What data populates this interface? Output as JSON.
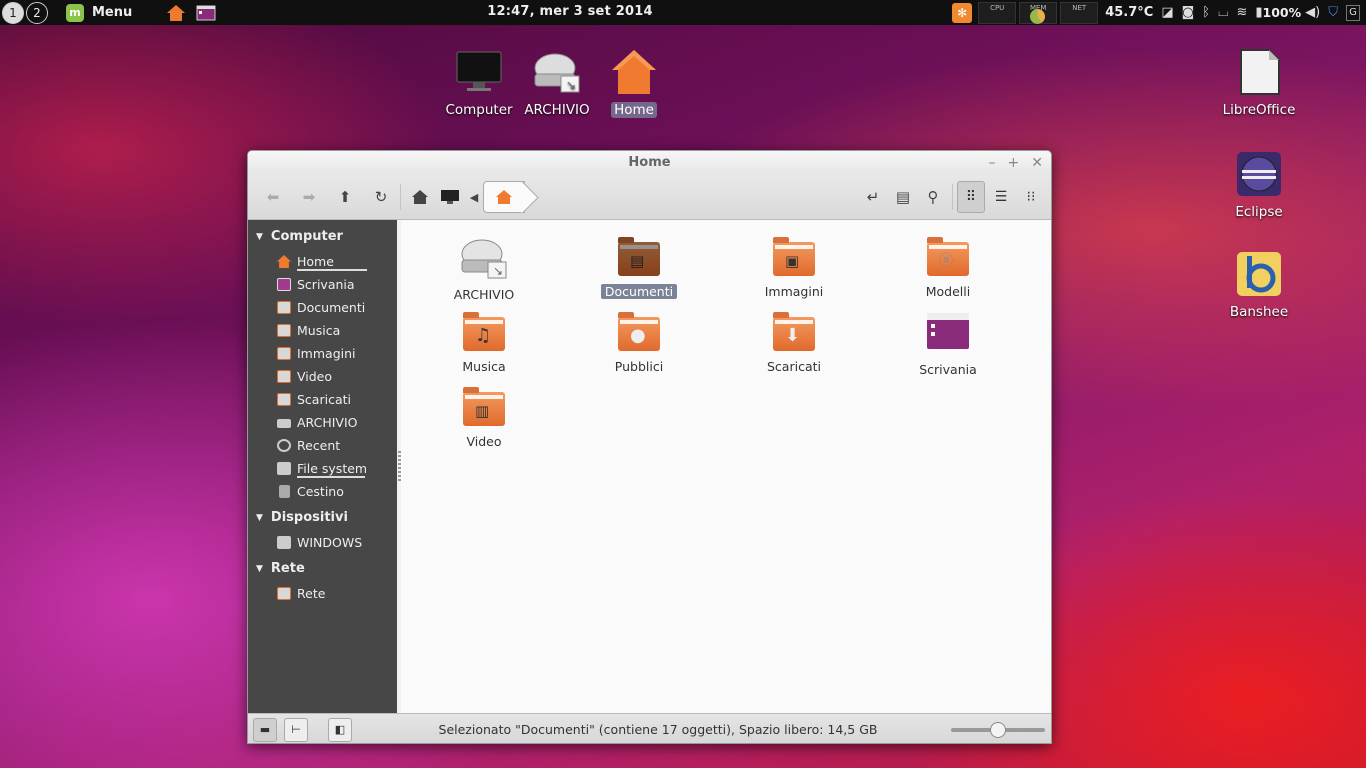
{
  "panel": {
    "workspaces": [
      "1",
      "2"
    ],
    "menu_label": "Menu",
    "clock": "12:47, mer  3 set 2014",
    "applets": {
      "cpu": "CPU",
      "mem": "MEM",
      "net": "NET"
    },
    "temperature": "45.7°C",
    "battery": "100%"
  },
  "desktop": {
    "icons": [
      {
        "label": "Computer"
      },
      {
        "label": "ARCHIVIO"
      },
      {
        "label": "Home"
      },
      {
        "label": "LibreOffice"
      },
      {
        "label": "Eclipse"
      },
      {
        "label": "Banshee"
      }
    ]
  },
  "window": {
    "title": "Home"
  },
  "sidebar": {
    "sections": [
      {
        "title": "Computer"
      },
      {
        "title": "Dispositivi"
      },
      {
        "title": "Rete"
      }
    ],
    "computer_items": [
      "Home",
      "Scrivania",
      "Documenti",
      "Musica",
      "Immagini",
      "Video",
      "Scaricati",
      "ARCHIVIO",
      "Recent",
      "File system",
      "Cestino"
    ],
    "device_items": [
      "WINDOWS"
    ],
    "network_items": [
      "Rete"
    ]
  },
  "files": [
    "ARCHIVIO",
    "Documenti",
    "Immagini",
    "Modelli",
    "Musica",
    "Pubblici",
    "Scaricati",
    "Scrivania",
    "Video"
  ],
  "status": {
    "text": "Selezionato \"Documenti\" (contiene 17 oggetti), Spazio libero: 14,5 GB"
  }
}
